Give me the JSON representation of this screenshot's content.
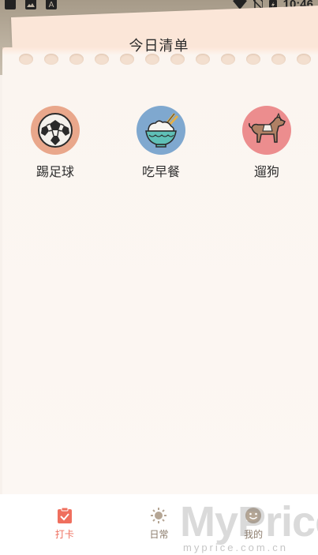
{
  "status_bar": {
    "time": "10:46",
    "icons": [
      "app-icon",
      "image-icon",
      "text-icon",
      "wifi-icon",
      "no-sim-icon",
      "battery-icon"
    ]
  },
  "header": {
    "title": "今日清单"
  },
  "habits": [
    {
      "label": "踢足球",
      "icon": "soccer-ball-icon",
      "color": "#e9a78b"
    },
    {
      "label": "吃早餐",
      "icon": "rice-bowl-icon",
      "color": "#7fa8cf"
    },
    {
      "label": "遛狗",
      "icon": "dog-icon",
      "color": "#ec8d8e"
    }
  ],
  "bottom_nav": {
    "items": [
      {
        "label": "打卡",
        "icon": "clipboard-check-icon",
        "active": true,
        "color": "#ef6f5e"
      },
      {
        "label": "日常",
        "icon": "sun-icon",
        "active": false,
        "color": "#8a7a6a"
      },
      {
        "label": "我的",
        "icon": "smiley-icon",
        "active": false,
        "color": "#8a7a6a"
      }
    ]
  },
  "watermark": {
    "brand": "MyPrice",
    "url": "myprice.com.cn"
  }
}
